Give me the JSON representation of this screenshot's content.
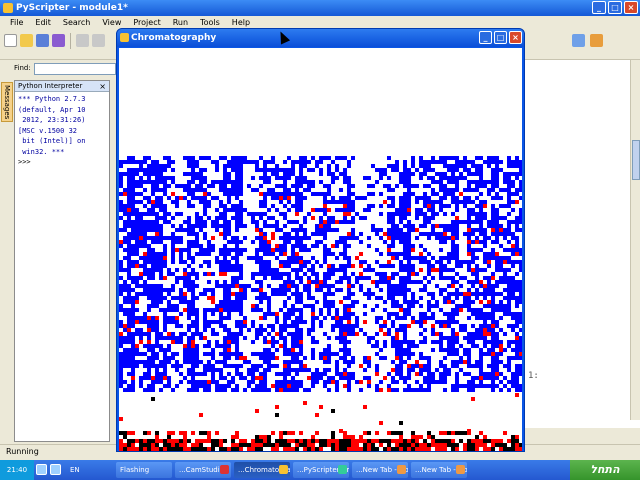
{
  "ide": {
    "title": "PyScripter - module1*",
    "menu": [
      "File",
      "Edit",
      "Search",
      "View",
      "Project",
      "Run",
      "Tools",
      "Help"
    ],
    "find_label": "Find:",
    "side_tab_label": "Messages",
    "interpreter_title": "Python Interpreter",
    "interpreter_text": "*** Python 2.7.3\n(default, Apr 10\n 2012, 23:31:26)\n[MSC v.1500 32\n bit (Intel)] on\n win32. ***",
    "prompt": ">>>",
    "code_fragment": "1:",
    "status": "Running"
  },
  "chromatography": {
    "title": "Chromatography",
    "colors": {
      "band": "#0000ff",
      "particle": "#ff0000",
      "background": "#ffffff",
      "dark": "#000000"
    }
  },
  "taskbar": {
    "clock": "21:40",
    "language": "EN",
    "tasks": [
      "Flashing",
      "...CamStudio - C",
      "...Chromatogra",
      "...PyScripter - m",
      "...New Tab - Go",
      "...New Tab - Go"
    ],
    "start_label": "התחל"
  }
}
